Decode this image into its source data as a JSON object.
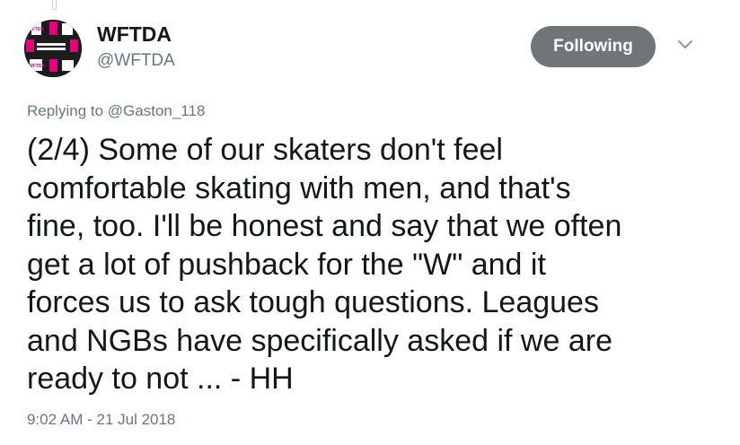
{
  "author": {
    "display_name": "WFTDA",
    "handle": "@WFTDA",
    "avatar_text": [
      "I AM WFTDA.",
      "I AM DERBY.",
      "WFTDA.",
      "DERBY.",
      "I AM",
      "I AM"
    ]
  },
  "follow_button": {
    "label": "Following"
  },
  "menu": {
    "icon": "chevron-down-icon"
  },
  "reply": {
    "prefix": "Replying to ",
    "handle": "@Gaston_118"
  },
  "tweet": {
    "text": "(2/4) Some of our skaters don't feel\ncomfortable skating with men, and that's\nfine, too. I'll be honest and say that we often\nget a lot of pushback for the \"W\" and it\nforces us to ask tough questions. Leagues\nand NGBs have specifically asked if we are\nready to not ... - HH"
  },
  "timestamp": "9:02 AM - 21 Jul 2018",
  "colors": {
    "follow_bg": "#707579",
    "muted": "#657786",
    "text": "#14171a",
    "avatar_pink": "#e6007e"
  }
}
